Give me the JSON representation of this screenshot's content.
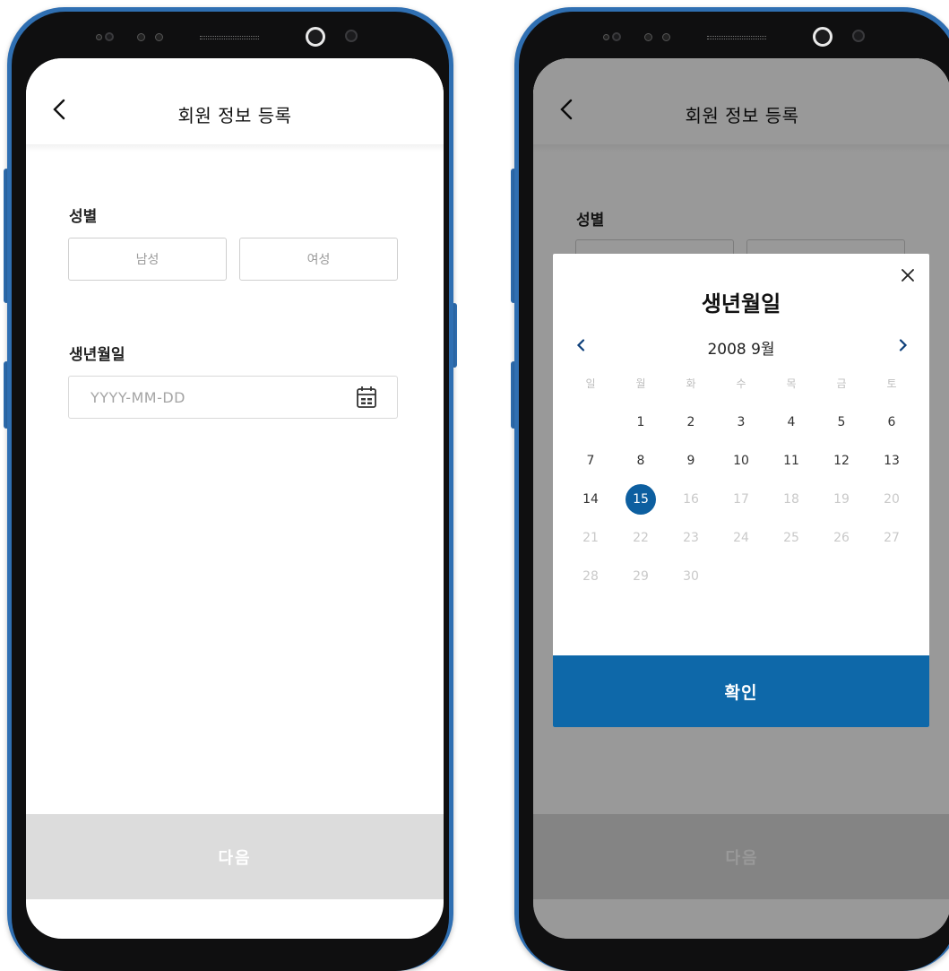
{
  "screens": [
    {
      "title": "회원 정보 등록",
      "gender_label": "성별",
      "gender_options": [
        "남성",
        "여성"
      ],
      "birth_label": "생년월일",
      "birth_placeholder": "YYYY-MM-DD",
      "next_label": "다음"
    },
    {
      "title": "회원 정보 등록",
      "gender_label": "성별",
      "next_label": "다음",
      "date_picker": {
        "title": "생년월일",
        "month_label": "2008 9월",
        "weekdays": [
          "일",
          "월",
          "화",
          "수",
          "목",
          "금",
          "토"
        ],
        "days": [
          "1",
          "2",
          "3",
          "4",
          "5",
          "6",
          "7",
          "8",
          "9",
          "10",
          "11",
          "12",
          "13",
          "14",
          "15",
          "16",
          "17",
          "18",
          "19",
          "20",
          "21",
          "22",
          "23",
          "24",
          "25",
          "26",
          "27",
          "28",
          "29",
          "30"
        ],
        "selected_day": "15",
        "confirm_label": "확인"
      }
    }
  ],
  "colors": {
    "frame": "#2f6fb2",
    "accent": "#0e68a9",
    "selected_day": "#0d5fa0",
    "next_bar": "#dcdcdc"
  }
}
